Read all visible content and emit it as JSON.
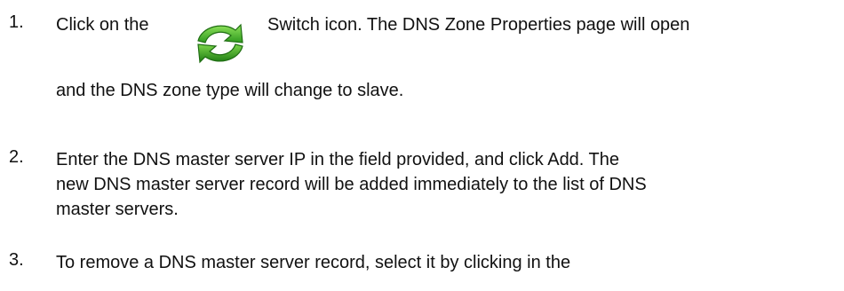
{
  "steps": [
    {
      "number": "1.",
      "text_before": "Click on the",
      "icon": "switch-icon",
      "text_after": "Switch icon. The DNS Zone Properties page will open",
      "line2": "and the DNS zone type will change to slave."
    },
    {
      "number": "2.",
      "lines": [
        "Enter the DNS master server IP in the field provided, and click Add. The",
        "new DNS master server record will be added immediately to the list of DNS",
        "master servers."
      ]
    },
    {
      "number": "3.",
      "lines": [
        "To remove a DNS master server record, select it by clicking in the"
      ]
    }
  ],
  "colors": {
    "icon_green_light": "#7cd64a",
    "icon_green_dark": "#2f9a1e"
  }
}
